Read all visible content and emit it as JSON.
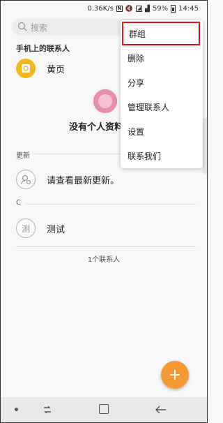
{
  "status_bar": {
    "speed": "0.36K/s",
    "nfc_icon": "nfc-icon",
    "battery_percent": "59%",
    "time": "14:45"
  },
  "search": {
    "placeholder": "搜索"
  },
  "sections": {
    "phone_contacts": "手机上的联系人",
    "updates": "更新",
    "letter_c": "C"
  },
  "contacts": {
    "yellow_pages": "黄页",
    "no_profile": "没有个人资料",
    "check_updates": "请查看最新更新。",
    "test_contact": "测试",
    "test_avatar": "测",
    "count": "1个联系人"
  },
  "menu": {
    "items": [
      {
        "label": "群组"
      },
      {
        "label": "删除"
      },
      {
        "label": "分享"
      },
      {
        "label": "管理联系人"
      },
      {
        "label": "设置"
      },
      {
        "label": "联系我们"
      }
    ]
  },
  "colors": {
    "accent": "#f39a37",
    "highlight_border": "#d9141c",
    "yellow_pages": "#f3b81b"
  }
}
